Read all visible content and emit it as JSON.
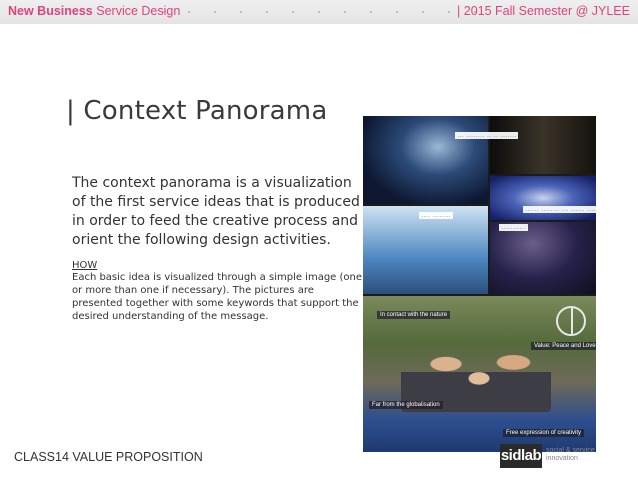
{
  "header": {
    "brand_left_bold": "New Business",
    "brand_left_rest": " Service Design",
    "brand_right": "| 2015 Fall Semester @ JYLEE",
    "accent_color": "#e0427e"
  },
  "slide": {
    "title": "| Context Panorama",
    "lead": "The context panorama is a visualization of the first service ideas that is produced in order to feed the creative process and orient the following design activities.",
    "how_label": "HOW",
    "how_body": "Each basic idea is visualized through a simple image (one or more than one if necessary). The pictures are presented together with some keywords that support the desired understanding of the message."
  },
  "collage": {
    "tags": [
      "--- -------- -- -- -------",
      "---- --------",
      "------ -------- --- ------ -----",
      "-----------"
    ],
    "captions": [
      "In contact with the nature",
      "Value: Peace and Love",
      "Far from the globalisation",
      "Free expression of creativity"
    ]
  },
  "footer": {
    "label": "CLASS14 VALUE PROPOSITION",
    "logo_mark": "sidlab",
    "logo_line1": "social & service",
    "logo_line2": "innovation"
  }
}
